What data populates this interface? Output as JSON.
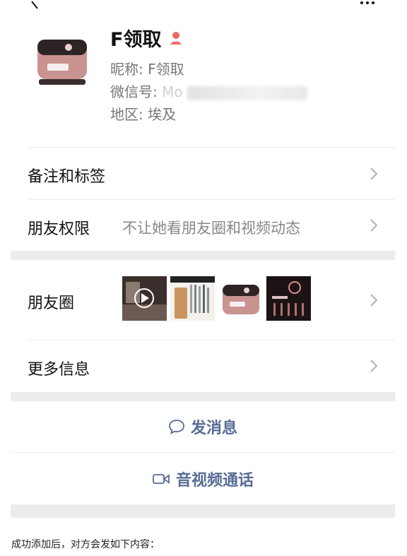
{
  "profile": {
    "name": "F领取",
    "nickname_label": "昵称:",
    "nickname_value": "F领取",
    "wechat_id_label": "微信号:",
    "wechat_id_value": "Mo",
    "region_label": "地区:",
    "region_value": "埃及"
  },
  "rows": {
    "remark_label": "备注和标签",
    "friend_perm_label": "朋友权限",
    "friend_perm_value": "不让她看朋友圈和视频动态",
    "moments_label": "朋友圈",
    "more_info_label": "更多信息"
  },
  "actions": {
    "message_label": "发消息",
    "call_label": "音视频通话"
  },
  "caption": "成功添加后，对方会发如下内容：",
  "colors": {
    "link": "#576b95",
    "gender_female": "#f06767",
    "separator": "#ececec"
  },
  "icons": [
    "back-icon",
    "more-icon",
    "female-icon",
    "chevron-right-icon",
    "chat-bubble-icon",
    "video-camera-icon",
    "play-icon"
  ]
}
